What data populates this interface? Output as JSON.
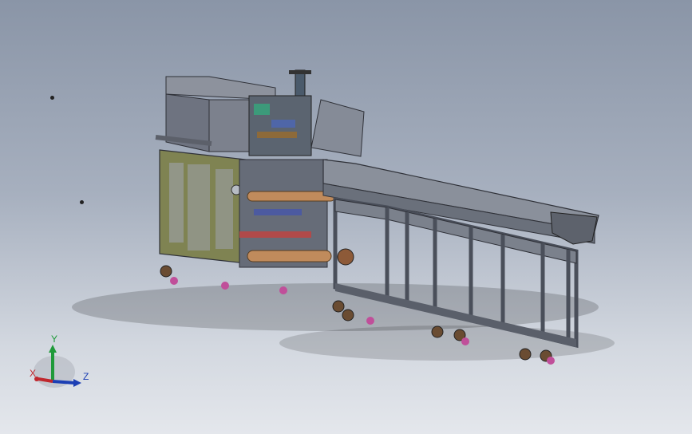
{
  "viewport": {
    "background_top": "#8a95a7",
    "background_bottom": "#e4e7ec",
    "model": "packaging-machine-assembly"
  },
  "triad": {
    "x_label": "X",
    "y_label": "Y",
    "z_label": "Z",
    "x_color": "#c0272d",
    "y_color": "#1f9a3a",
    "z_color": "#1c3fb4"
  }
}
